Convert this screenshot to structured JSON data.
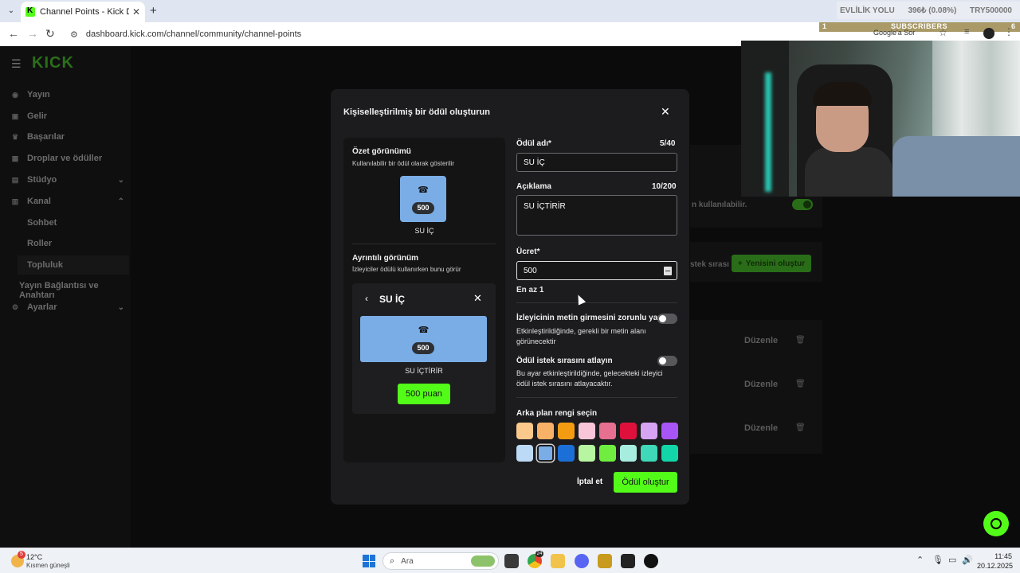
{
  "browser": {
    "tab_title": "Channel Points - Kick Dashboard",
    "url": "dashboard.kick.com/channel/community/channel-points",
    "google_label": "Google'a Sor",
    "ticker": [
      "EVLİLİK YOLU",
      "396₺ (0.08%)",
      "TRY500000"
    ],
    "subs": {
      "left": "1",
      "label": "SUBSCRIBERS",
      "right": "6"
    }
  },
  "sidebar": {
    "logo": "KICK",
    "items": [
      {
        "label": "Yayın",
        "icon": "broadcast-icon"
      },
      {
        "label": "Gelir",
        "icon": "revenue-icon"
      },
      {
        "label": "Başarılar",
        "icon": "trophy-icon"
      },
      {
        "label": "Droplar ve ödüller",
        "icon": "gift-icon"
      },
      {
        "label": "Stüdyo",
        "icon": "studio-icon"
      },
      {
        "label": "Kanal",
        "icon": "channel-icon"
      },
      {
        "label": "Ayarlar",
        "icon": "gear-icon"
      }
    ],
    "sub_items": [
      "Sohbet",
      "Roller",
      "Topluluk",
      "Yayın Bağlantısı ve Anahtarı"
    ]
  },
  "background": {
    "toggle_text": "n kullanılabilir.",
    "queue_text": "stek sırası",
    "new_button": "Yenisini oluştur",
    "edit_label": "Düzenle"
  },
  "modal": {
    "title": "Kişiselleştirilmiş bir ödül oluşturun",
    "summary_title": "Özet görünümü",
    "summary_sub": "Kullanılabilir bir ödül olarak gösterilir",
    "cost_badge": "500",
    "reward_name_display": "SU İÇ",
    "detail_title": "Ayrıntılı görünüm",
    "detail_sub": "İzleyiciler ödülü kullanırken bunu görür",
    "detail_card_title": "SU İÇ",
    "detail_desc": "SU İÇTİRİR",
    "redeem_button": "500 puan",
    "name_label": "Ödül adı*",
    "name_count": "5/40",
    "name_value": "SU İÇ",
    "desc_label": "Açıklama",
    "desc_count": "10/200",
    "desc_value": "SU İÇTİRİR",
    "cost_label": "Ücret*",
    "cost_value": "500",
    "cost_hint": "En az 1",
    "require_text_label": "İzleyicinin metin girmesini zorunlu yap",
    "require_text_desc": "Etkinleştirildiğinde, gerekli bir metin alanı görünecektir",
    "require_text_on": false,
    "skip_queue_label": "Ödül istek sırasını atlayın",
    "skip_queue_desc": "Bu ayar etkinleştirildiğinde, gelecekteki izleyici ödül istek sırasını atlayacaktır.",
    "skip_queue_on": false,
    "color_label": "Arka plan rengi seçin",
    "colors_row1": [
      "#fbc98c",
      "#f7b267",
      "#f39c12",
      "#f7c6d9",
      "#e76f8f",
      "#e0103c",
      "#d6a4f2",
      "#a855f7"
    ],
    "colors_row2": [
      "#bcdaf5",
      "#7aade6",
      "#1d6fd8",
      "#b7f5a0",
      "#6fee3f",
      "#a6ecdf",
      "#3fd8b8",
      "#12d6a8"
    ],
    "selected_color": "#7aade6",
    "cancel_button": "İptal et",
    "create_button": "Ödül oluştur"
  },
  "taskbar": {
    "weather_badge": "5",
    "temp": "12°C",
    "condition": "Kısmen güneşli",
    "search_placeholder": "Ara",
    "chrome_badge": "24",
    "time": "11:45",
    "date": "20.12.2025"
  }
}
